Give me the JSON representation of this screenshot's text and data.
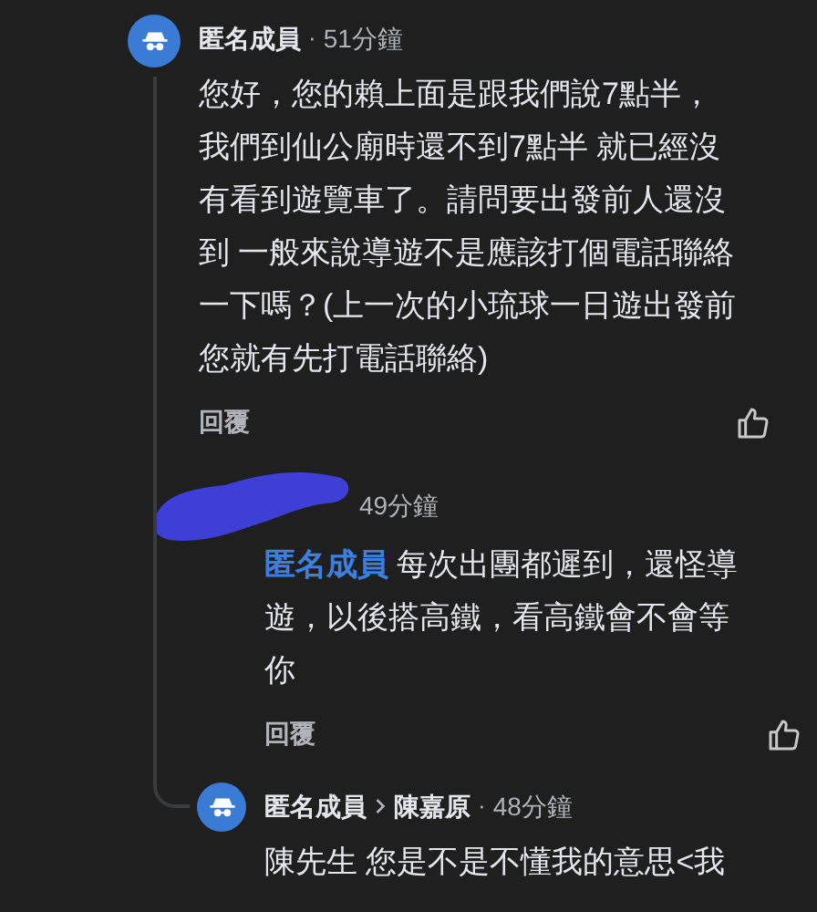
{
  "comments": [
    {
      "author": "匿名成員",
      "separator": "·",
      "time": "51分鐘",
      "author_redacted": false,
      "lines": [
        "您好，您的賴上面是跟我們說7點半，",
        "我們到仙公廟時還不到7點半 就已經沒",
        "有看到遊覽車了。請問要出發前人還沒",
        "到 一般來說導遊不是應該打個電話聯絡",
        "一下嗎？(上一次的小琉球一日遊出發前",
        "您就有先打電話聯絡)"
      ],
      "reply_label": "回覆",
      "children": [
        {
          "time": "49分鐘",
          "author_redacted": true,
          "mention": "匿名成員",
          "lines": [
            "每次出團都遲到，還怪導",
            "遊，以後搭高鐵，看高鐵會不會等",
            "你"
          ],
          "reply_label": "回覆"
        },
        {
          "author": "匿名成員",
          "to": "陳嘉原",
          "separator": "·",
          "time": "48分鐘",
          "author_redacted": false,
          "lines": [
            "陳先生 您是不是不懂我的意思<我"
          ]
        }
      ]
    }
  ]
}
